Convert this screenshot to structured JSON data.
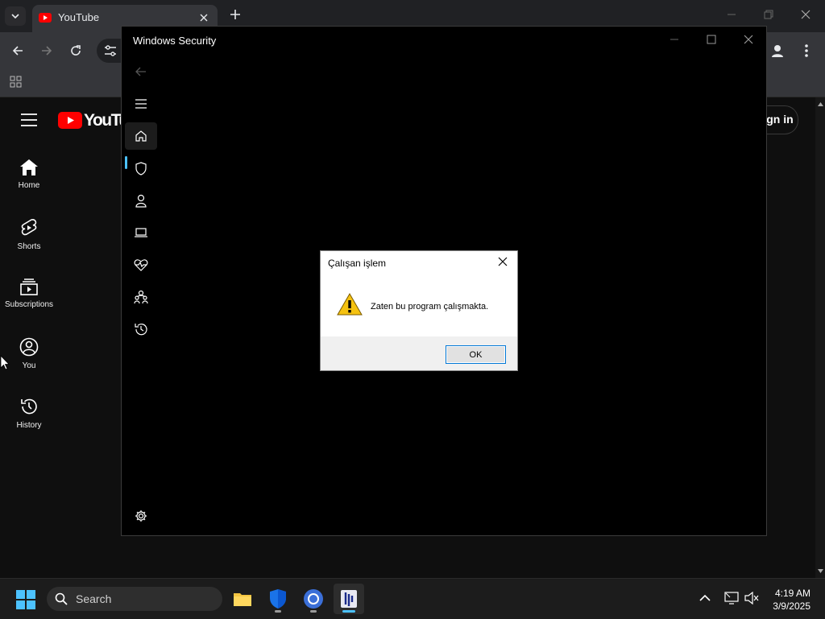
{
  "browser": {
    "tab_title": "YouTube",
    "youtube_logo_text": "YouTube",
    "sign_in_label": "Sign in"
  },
  "youtube_nav": [
    {
      "label": "Home",
      "icon": "home-icon"
    },
    {
      "label": "Shorts",
      "icon": "shorts-icon"
    },
    {
      "label": "Subscriptions",
      "icon": "subscriptions-icon"
    },
    {
      "label": "You",
      "icon": "you-icon"
    },
    {
      "label": "History",
      "icon": "history-icon"
    }
  ],
  "windows_security": {
    "title": "Windows Security",
    "nav_icons": [
      "back-arrow-icon",
      "hamburger-icon",
      "home-icon",
      "shield-icon",
      "account-icon",
      "device-icon",
      "health-icon",
      "family-icon",
      "history-icon",
      "settings-icon"
    ]
  },
  "dialog": {
    "title": "Çalışan işlem",
    "message": "Zaten bu program çalışmakta.",
    "ok_label": "OK"
  },
  "taskbar": {
    "search_placeholder": "Search",
    "time": "4:19 AM",
    "date": "3/9/2025",
    "apps": [
      "file-explorer-icon",
      "windows-security-icon",
      "browser-icon",
      "app-icon"
    ]
  },
  "colors": {
    "accent": "#4cc2ff",
    "youtube_red": "#ff0000",
    "dialog_border": "#0078d7"
  }
}
